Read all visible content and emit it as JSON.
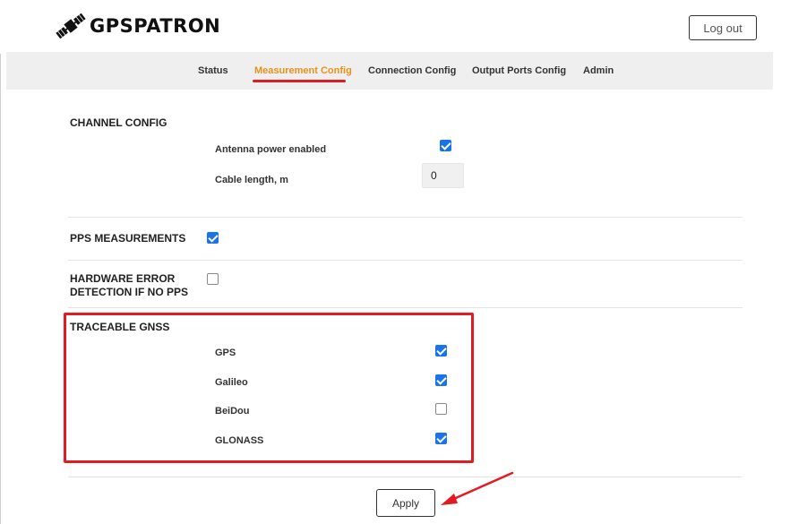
{
  "header": {
    "brand": "GPSPATRON",
    "logout_label": "Log out"
  },
  "nav": {
    "items": [
      {
        "label": "Status",
        "active": false
      },
      {
        "label": "Measurement Config",
        "active": true
      },
      {
        "label": "Connection Config",
        "active": false
      },
      {
        "label": "Output Ports Config",
        "active": false
      },
      {
        "label": "Admin",
        "active": false
      }
    ]
  },
  "channel_config": {
    "title": "CHANNEL CONFIG",
    "antenna_power_label": "Antenna power enabled",
    "antenna_power_enabled": true,
    "cable_length_label": "Cable length, m",
    "cable_length_value": "0"
  },
  "pps_measurements": {
    "title": "PPS MEASUREMENTS",
    "enabled": true
  },
  "hardware_error": {
    "title_line1": "HARDWARE ERROR",
    "title_line2": "DETECTION IF NO PPS",
    "enabled": false
  },
  "traceable_gnss": {
    "title": "TRACEABLE GNSS",
    "systems": [
      {
        "label": "GPS",
        "checked": true
      },
      {
        "label": "Galileo",
        "checked": true
      },
      {
        "label": "BeiDou",
        "checked": false
      },
      {
        "label": "GLONASS",
        "checked": true
      }
    ]
  },
  "actions": {
    "apply_label": "Apply"
  },
  "colors": {
    "accent": "#e8921e",
    "annotation_red": "#e21b23",
    "checkbox_blue": "#1a73e8"
  }
}
